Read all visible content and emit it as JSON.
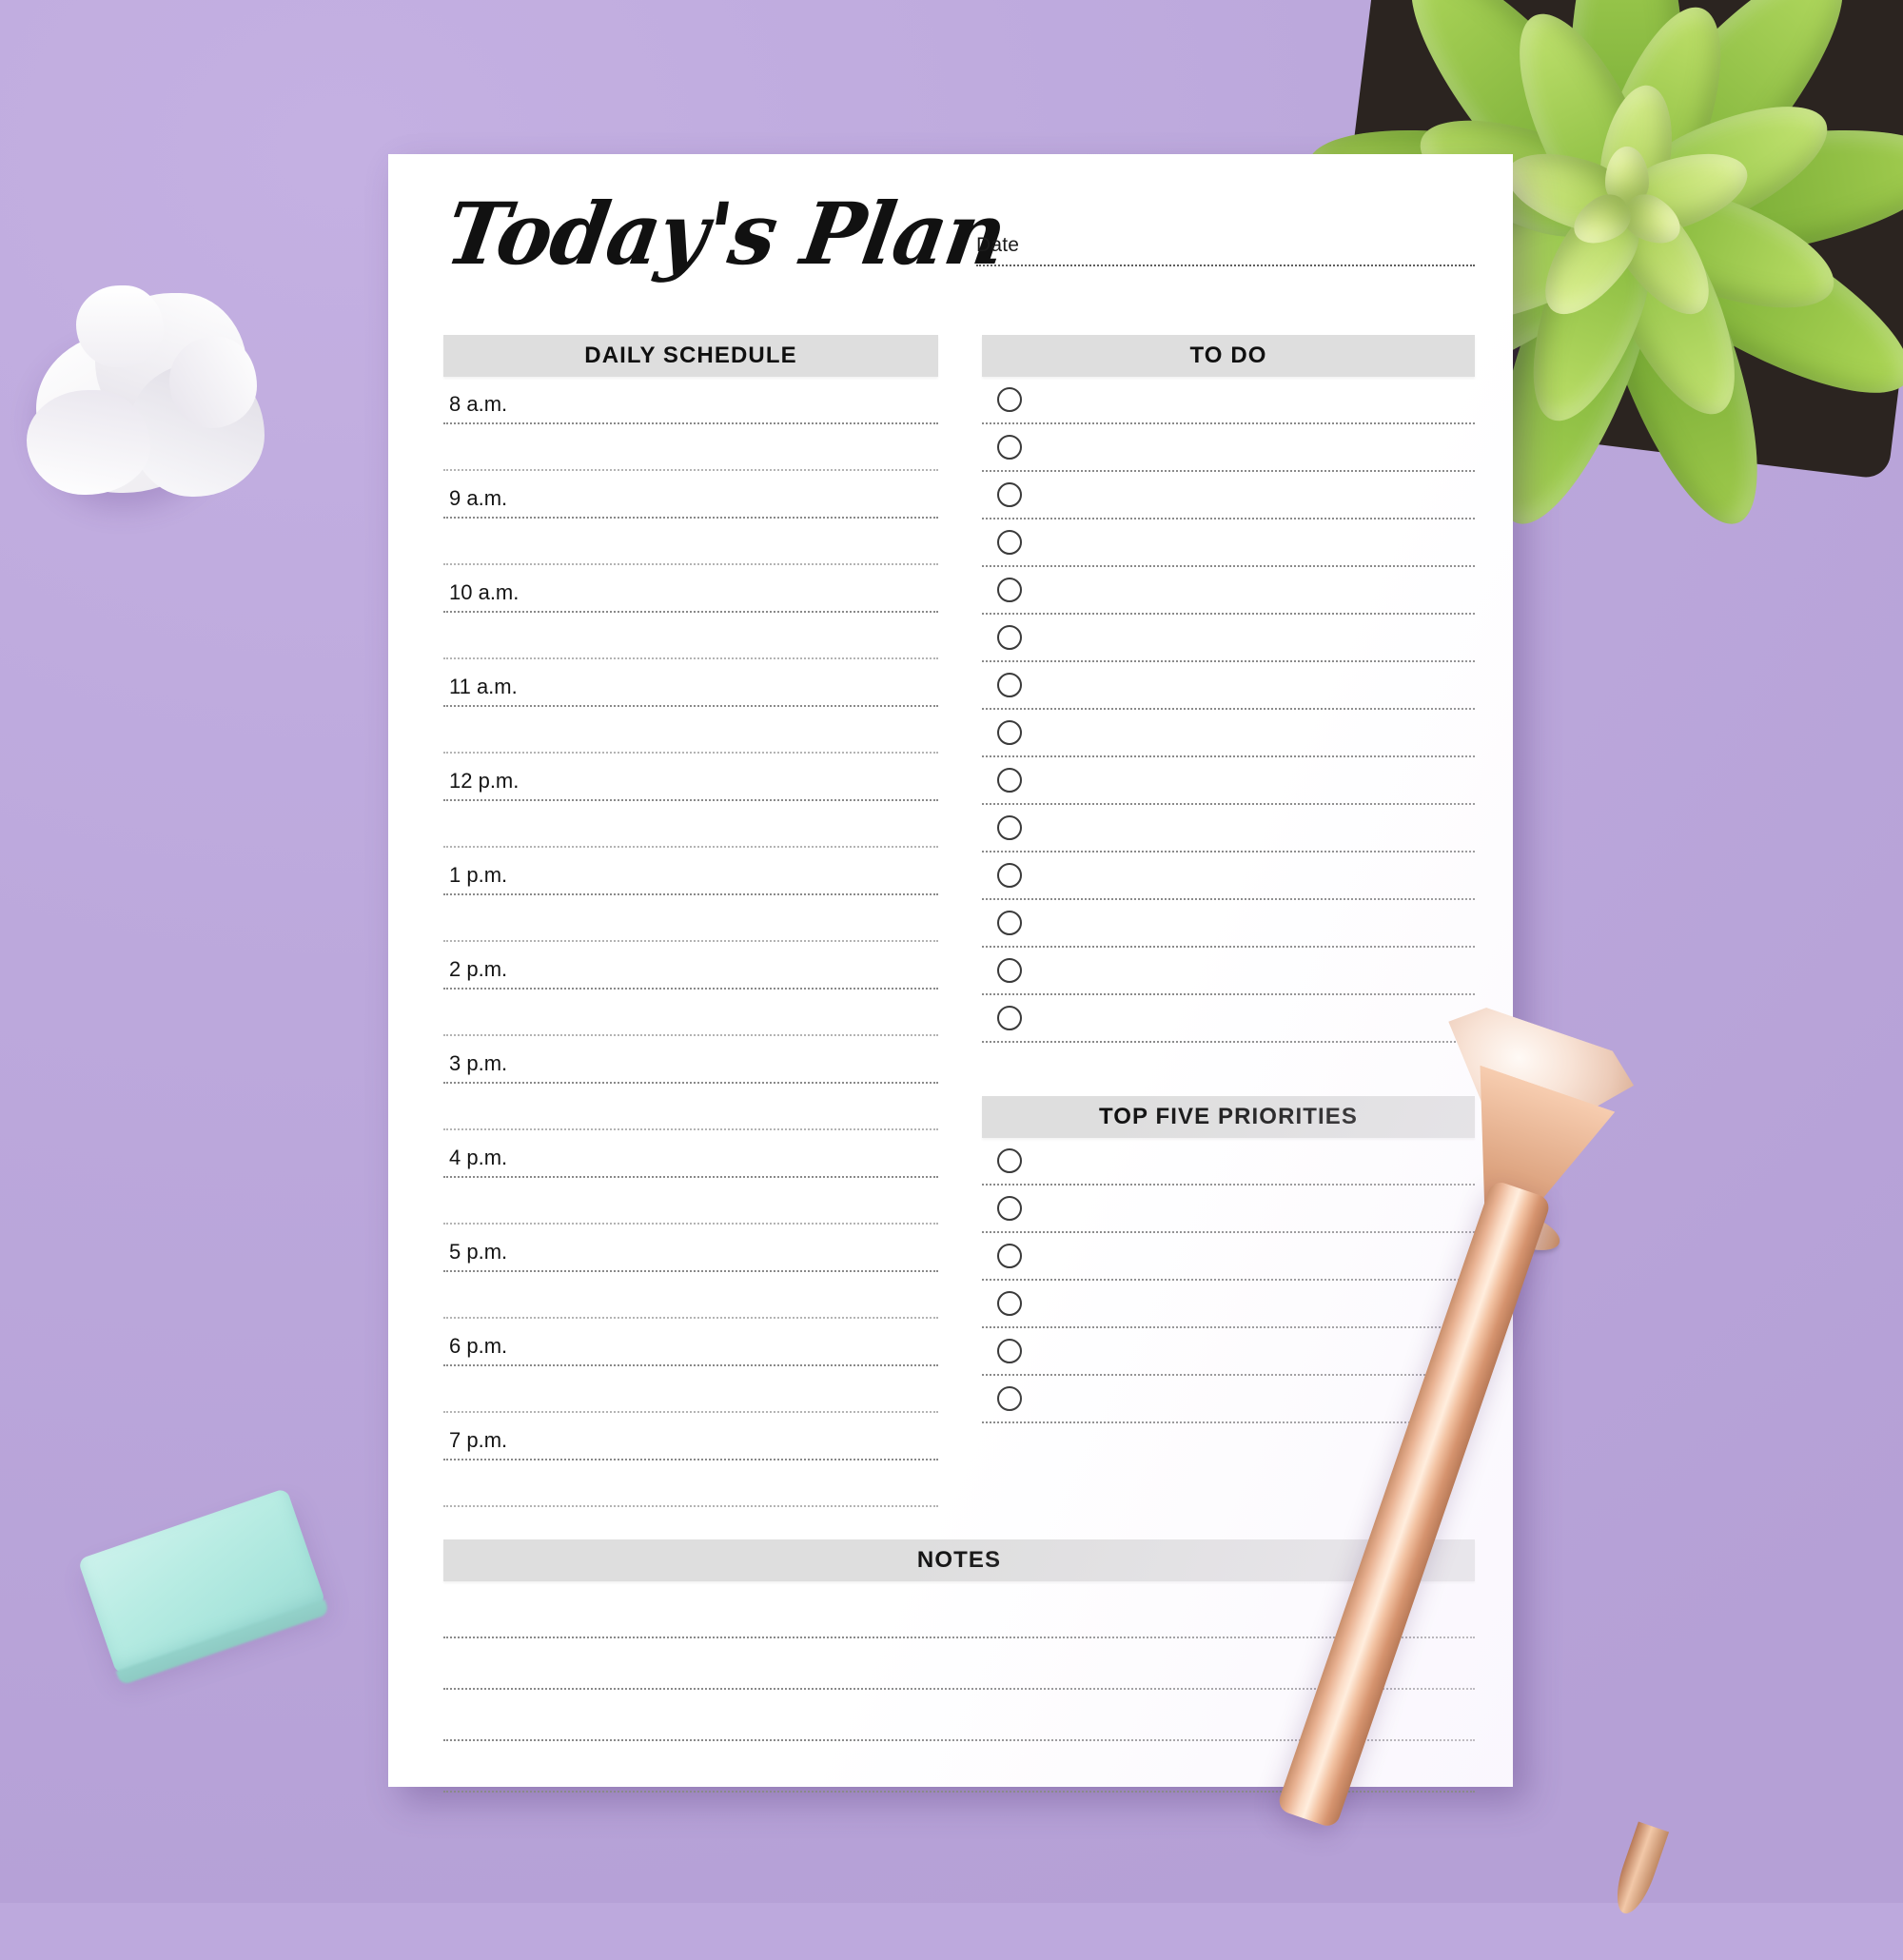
{
  "scene": {
    "background_color": "#bda9dd",
    "objects": [
      {
        "name": "crumpled-paper-ball",
        "color": "#f6f5f6"
      },
      {
        "name": "mint-eraser",
        "color": "#b5ece3"
      },
      {
        "name": "succulent-plant",
        "color": "#8cc63f"
      },
      {
        "name": "rose-gold-pen",
        "color": "#e8b191"
      }
    ]
  },
  "document": {
    "title": "Today's Plan",
    "paper_color": "#ffffff",
    "header_bar_color": "#dedede",
    "date": {
      "label": "Date",
      "value": "",
      "placeholder": ""
    },
    "sections": {
      "daily_schedule": {
        "heading": "DAILY SCHEDULE",
        "rows": [
          {
            "time": "8 a.m."
          },
          {
            "time": ""
          },
          {
            "time": "9 a.m."
          },
          {
            "time": ""
          },
          {
            "time": "10 a.m."
          },
          {
            "time": ""
          },
          {
            "time": "11 a.m."
          },
          {
            "time": ""
          },
          {
            "time": "12 p.m."
          },
          {
            "time": ""
          },
          {
            "time": "1 p.m."
          },
          {
            "time": ""
          },
          {
            "time": "2 p.m."
          },
          {
            "time": ""
          },
          {
            "time": "3 p.m."
          },
          {
            "time": ""
          },
          {
            "time": "4 p.m."
          },
          {
            "time": ""
          },
          {
            "time": "5 p.m."
          },
          {
            "time": ""
          },
          {
            "time": "6 p.m."
          },
          {
            "time": ""
          },
          {
            "time": "7 p.m."
          },
          {
            "time": ""
          }
        ]
      },
      "to_do": {
        "heading": "TO DO",
        "items": [
          "",
          "",
          "",
          "",
          "",
          "",
          "",
          "",
          "",
          "",
          "",
          "",
          "",
          ""
        ]
      },
      "top_five_priorities": {
        "heading": "TOP FIVE PRIORITIES",
        "items": [
          "",
          "",
          "",
          "",
          "",
          ""
        ]
      },
      "notes": {
        "heading": "NOTES",
        "lines": [
          "",
          "",
          "",
          ""
        ]
      }
    }
  }
}
